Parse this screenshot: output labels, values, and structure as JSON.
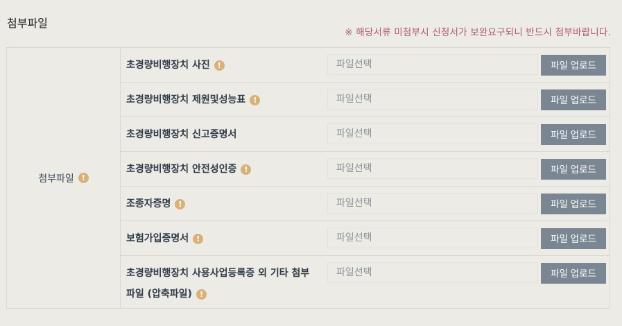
{
  "section": {
    "title": "첨부파일",
    "notice": "※ 해당서류 미첨부시 신청서가 보완요구되니 반드시 첨부바랍니다."
  },
  "table": {
    "row_header": "첨부파일",
    "info_icon": "!",
    "rows": [
      {
        "label": "초경량비행장치 사진",
        "has_info": true,
        "placeholder": "파일선택",
        "button": "파일 업로드"
      },
      {
        "label": "초경량비행장치 제원및성능표",
        "has_info": true,
        "placeholder": "파일선택",
        "button": "파일 업로드"
      },
      {
        "label": "초경량비행장치 신고증명서",
        "has_info": false,
        "placeholder": "파일선택",
        "button": "파일 업로드"
      },
      {
        "label": "초경량비행장치 안전성인증",
        "has_info": true,
        "placeholder": "파일선택",
        "button": "파일 업로드"
      },
      {
        "label": "조종자증명",
        "has_info": true,
        "placeholder": "파일선택",
        "button": "파일 업로드"
      },
      {
        "label": "보험가입증명서",
        "has_info": true,
        "placeholder": "파일선택",
        "button": "파일 업로드"
      },
      {
        "label": "초경량비행장치 사용사업등록증 외 기타 첨부파일 (압축파일)",
        "has_info": true,
        "placeholder": "파일선택",
        "button": "파일 업로드"
      }
    ]
  },
  "colors": {
    "background": "#ecebe6",
    "notice": "#b05a6a",
    "button": "#7a8692",
    "info_icon": "#d9b07a"
  }
}
